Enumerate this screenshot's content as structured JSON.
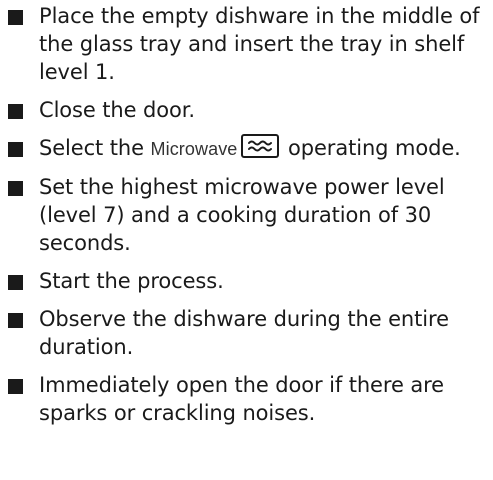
{
  "steps": [
    {
      "text": "Place the empty dishware in the middle of the glass tray and insert the tray in shelf level 1."
    },
    {
      "text": "Close the door."
    },
    {
      "prefix": "Select the ",
      "mode_name": "Microwave",
      "mode_icon": "microwave-waves-icon",
      "suffix": " operating mode."
    },
    {
      "text": "Set the highest microwave power level (level 7) and a cooking duration of 30 seconds."
    },
    {
      "text": "Start the process."
    },
    {
      "text": "Observe the dishware during the entire duration."
    },
    {
      "text": "Immediately open the door if there are sparks or crackling noises."
    }
  ]
}
